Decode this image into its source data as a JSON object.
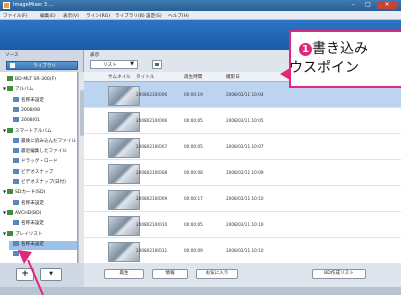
{
  "window": {
    "title": "ImageMixer 3 ...",
    "controls": [
      "–",
      "□",
      "✕"
    ]
  },
  "menu": [
    "ファイル(F)",
    "編集(E)",
    "表示(V)",
    "ライン(RG)",
    "ライブラリ(B)",
    "設定(S)",
    "ヘルプ(H)"
  ],
  "banner": {
    "text": "I"
  },
  "left_panel": {
    "header_label": "ソース",
    "library_button": "ライブラリ",
    "tree": [
      {
        "label": "BD-MLT SR-300(F)",
        "level": 0,
        "fold": ""
      },
      {
        "label": "アルバム",
        "level": 0,
        "fold": "▼"
      },
      {
        "label": "名称未設定",
        "level": 1,
        "fold": ""
      },
      {
        "label": "2008/08",
        "level": 1,
        "fold": ""
      },
      {
        "label": "2008/01",
        "level": 1,
        "fold": ""
      },
      {
        "label": "スマートアルバム",
        "level": 0,
        "fold": "▼"
      },
      {
        "label": "最後に読み込んだファイル",
        "level": 1,
        "fold": ""
      },
      {
        "label": "最近編集したファイル",
        "level": 1,
        "fold": ""
      },
      {
        "label": "ドラッグ・ロード",
        "level": 1,
        "fold": ""
      },
      {
        "label": "ビデオスナップ",
        "level": 1,
        "fold": ""
      },
      {
        "label": "ビデオスナップ(日付)",
        "level": 1,
        "fold": ""
      },
      {
        "label": "SDカード(SD)",
        "level": 0,
        "fold": "▼"
      },
      {
        "label": "名称未設定",
        "level": 1,
        "fold": ""
      },
      {
        "label": "AVCHD(BD)",
        "level": 0,
        "fold": "▼"
      },
      {
        "label": "名称未設定",
        "level": 1,
        "fold": ""
      },
      {
        "label": "プレイリスト",
        "level": 0,
        "fold": "▼"
      },
      {
        "label": "名称未設定",
        "level": 1,
        "fold": ""
      },
      {
        "label": "",
        "level": 1,
        "fold": ""
      }
    ],
    "add_button": "+",
    "menu_button": "▼"
  },
  "list": {
    "header_label": "表示",
    "view_value": "リスト",
    "view_arrow": "▼",
    "columns": [
      "サムネイル",
      "タイトル",
      "再生時間",
      "撮影日"
    ],
    "rows": [
      {
        "title": "20080210IO06",
        "duration": "00:00:19",
        "date": "2008/02/11 10:04",
        "selected": true
      },
      {
        "title": "20080210IO06",
        "duration": "00:00:05",
        "date": "2008/02/11 10:05",
        "selected": false
      },
      {
        "title": "20080210IO07",
        "duration": "00:00:05",
        "date": "2008/02/11 10:07",
        "selected": false
      },
      {
        "title": "20080210IO08",
        "duration": "00:00:08",
        "date": "2008/02/11 10:09",
        "selected": false
      },
      {
        "title": "20080210IO09",
        "duration": "00:00:17",
        "date": "2008/02/11 10:10",
        "selected": false
      },
      {
        "title": "20080210IO10",
        "duration": "00:00:05",
        "date": "2008/02/11 10:10",
        "selected": false
      },
      {
        "title": "20080210IO11",
        "duration": "00:00:09",
        "date": "2008/02/11 10:10",
        "selected": false
      }
    ],
    "buttons": [
      "再生",
      "情報",
      "お気に入り",
      "BD作成リスト"
    ]
  },
  "callout": {
    "number": "1",
    "line1": "書き込み",
    "line2": "ウスポイン"
  },
  "colors": {
    "accent": "#e0287a",
    "banner": "#2d74c6",
    "selection": "#bcd4ef"
  }
}
